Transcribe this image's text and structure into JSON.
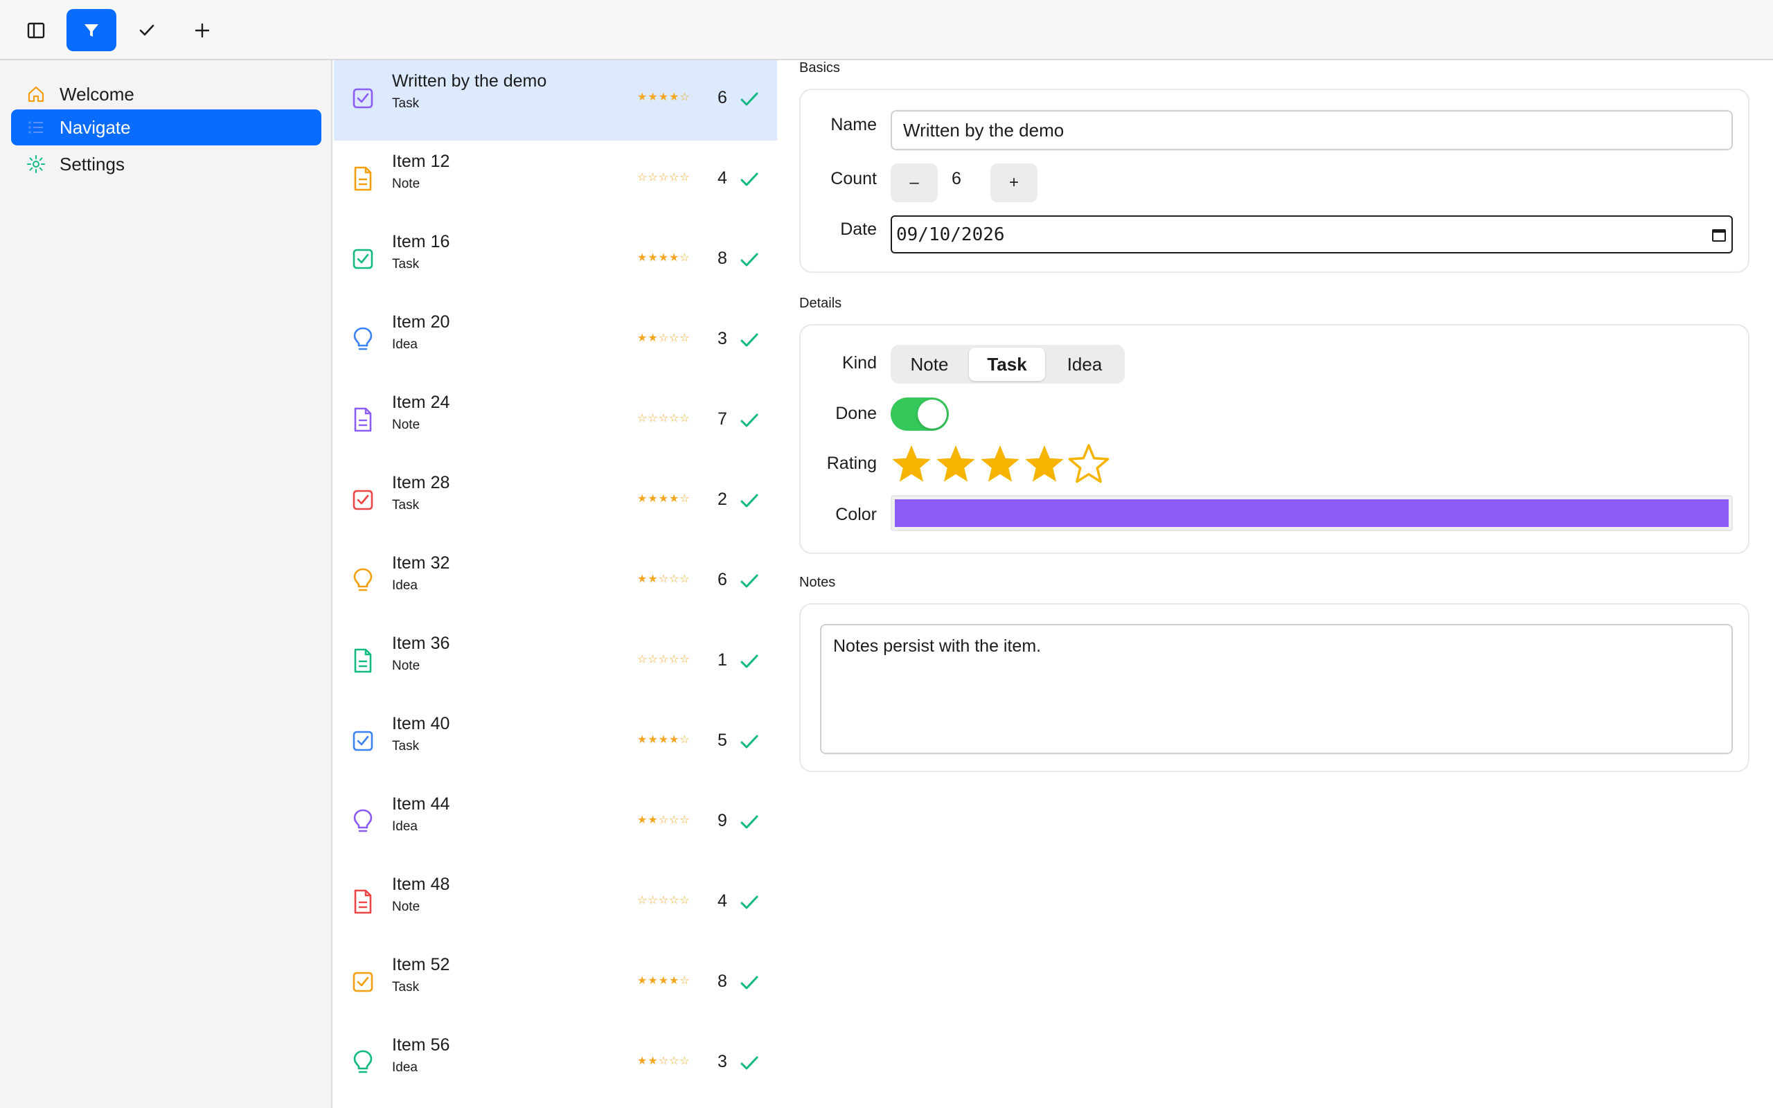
{
  "toolbar": {
    "buttons": [
      {
        "icon": "sidebar-toggle-icon",
        "active": false
      },
      {
        "icon": "filter-icon",
        "active": true
      },
      {
        "icon": "checkmark-icon",
        "active": false
      },
      {
        "icon": "plus-icon",
        "active": false
      }
    ]
  },
  "sidebar": {
    "items": [
      {
        "label": "Welcome",
        "icon": "home-icon",
        "active": false
      },
      {
        "label": "Navigate",
        "icon": "list-icon",
        "active": true
      },
      {
        "label": "Settings",
        "icon": "gear-icon",
        "active": false
      }
    ]
  },
  "list": {
    "items": [
      {
        "title": "Written by the demo",
        "kind": "Task",
        "rating": 4,
        "count": "6",
        "done": true,
        "color": "#8b5cf6",
        "selected": true
      },
      {
        "title": "Item 12",
        "kind": "Note",
        "rating": 0,
        "count": "4",
        "done": true,
        "color": "#f59e0b"
      },
      {
        "title": "Item 16",
        "kind": "Task",
        "rating": 4,
        "count": "8",
        "done": true,
        "color": "#10b981"
      },
      {
        "title": "Item 20",
        "kind": "Idea",
        "rating": 2,
        "count": "3",
        "done": true,
        "color": "#3b82f6"
      },
      {
        "title": "Item 24",
        "kind": "Note",
        "rating": 0,
        "count": "7",
        "done": true,
        "color": "#8b5cf6"
      },
      {
        "title": "Item 28",
        "kind": "Task",
        "rating": 4,
        "count": "2",
        "done": true,
        "color": "#ef4444"
      },
      {
        "title": "Item 32",
        "kind": "Idea",
        "rating": 2,
        "count": "6",
        "done": true,
        "color": "#f59e0b"
      },
      {
        "title": "Item 36",
        "kind": "Note",
        "rating": 0,
        "count": "1",
        "done": true,
        "color": "#10b981"
      },
      {
        "title": "Item 40",
        "kind": "Task",
        "rating": 4,
        "count": "5",
        "done": true,
        "color": "#3b82f6"
      },
      {
        "title": "Item 44",
        "kind": "Idea",
        "rating": 2,
        "count": "9",
        "done": true,
        "color": "#8b5cf6"
      },
      {
        "title": "Item 48",
        "kind": "Note",
        "rating": 0,
        "count": "4",
        "done": true,
        "color": "#ef4444"
      },
      {
        "title": "Item 52",
        "kind": "Task",
        "rating": 4,
        "count": "8",
        "done": true,
        "color": "#f59e0b"
      },
      {
        "title": "Item 56",
        "kind": "Idea",
        "rating": 2,
        "count": "3",
        "done": true,
        "color": "#10b981"
      }
    ]
  },
  "detail": {
    "basics": {
      "section_label": "Basics",
      "name_label": "Name",
      "name_value": "Written by the demo",
      "count_label": "Count",
      "count_value": "6",
      "minus_label": "–",
      "plus_label": "+",
      "date_label": "Date",
      "date_value": "09/10/2026"
    },
    "details": {
      "section_label": "Details",
      "kind_label": "Kind",
      "kind_options": [
        "Note",
        "Task",
        "Idea"
      ],
      "kind_selected": "Task",
      "done_label": "Done",
      "done_value": true,
      "rating_label": "Rating",
      "rating_value": 4,
      "rating_max": 5,
      "color_label": "Color",
      "color_value": "#8b5cf6"
    },
    "notes": {
      "section_label": "Notes",
      "text": "Notes persist with the item."
    }
  },
  "colors": {
    "accent": "#0a6cff",
    "star": "#f5b400",
    "done_check": "#10b981",
    "toggle_on": "#34c759"
  }
}
